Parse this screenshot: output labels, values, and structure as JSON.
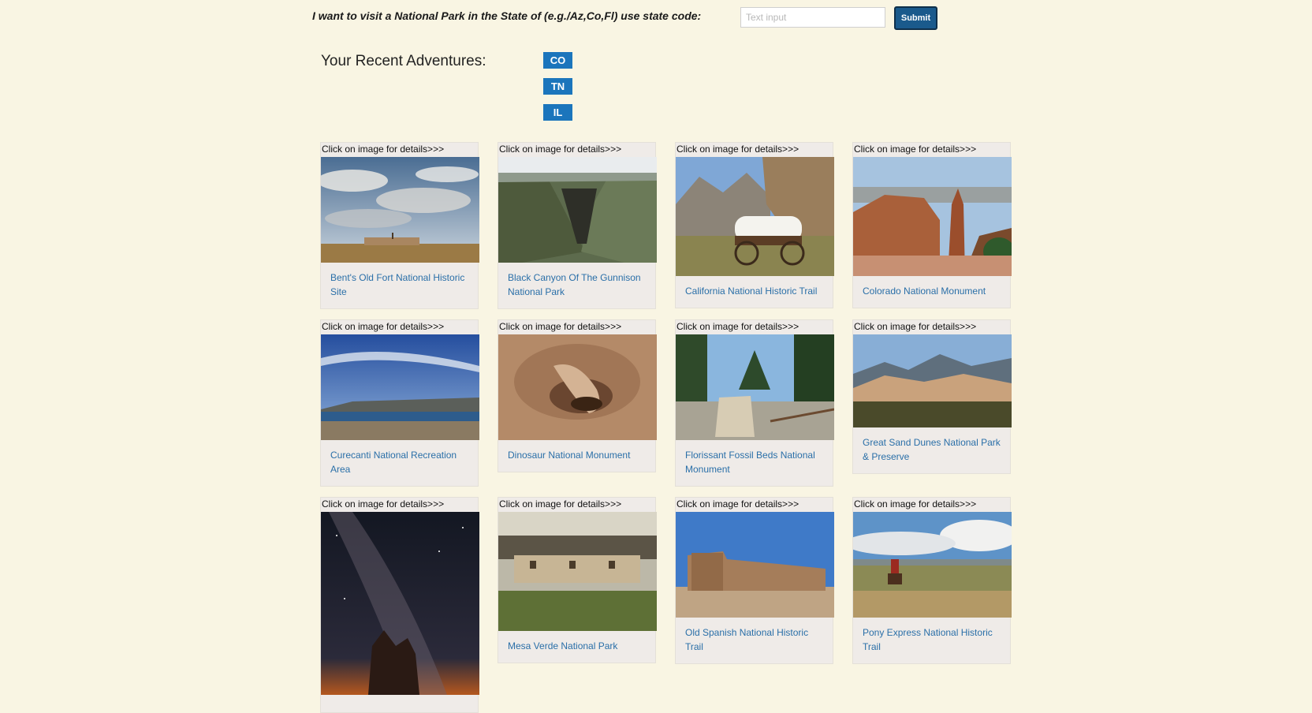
{
  "search": {
    "prompt": "I want to visit a National Park in the State of (e.g./Az,Co,Fl) use state code:",
    "placeholder": "Text input",
    "submit_label": "Submit"
  },
  "recent": {
    "title": "Your Recent Adventures:",
    "states": [
      "CO",
      "TN",
      "IL"
    ]
  },
  "parks": [
    {
      "hint": "Click on image for details>>>",
      "name": "Bent's Old Fort National Historic Site"
    },
    {
      "hint": "Click on image for details>>>",
      "name": "Black Canyon Of The Gunnison National Park"
    },
    {
      "hint": "Click on image for details>>>",
      "name": "California National Historic Trail"
    },
    {
      "hint": "Click on image for details>>>",
      "name": "Colorado National Monument"
    },
    {
      "hint": "Click on image for details>>>",
      "name": "Curecanti National Recreation Area"
    },
    {
      "hint": "Click on image for details>>>",
      "name": "Dinosaur National Monument"
    },
    {
      "hint": "Click on image for details>>>",
      "name": "Florissant Fossil Beds National Monument"
    },
    {
      "hint": "Click on image for details>>>",
      "name": "Great Sand Dunes National Park & Preserve"
    },
    {
      "hint": "Click on image for details>>>",
      "name": ""
    },
    {
      "hint": "Click on image for details>>>",
      "name": "Mesa Verde National Park"
    },
    {
      "hint": "Click on image for details>>>",
      "name": "Old Spanish National Historic Trail"
    },
    {
      "hint": "Click on image for details>>>",
      "name": "Pony Express National Historic Trail"
    }
  ]
}
